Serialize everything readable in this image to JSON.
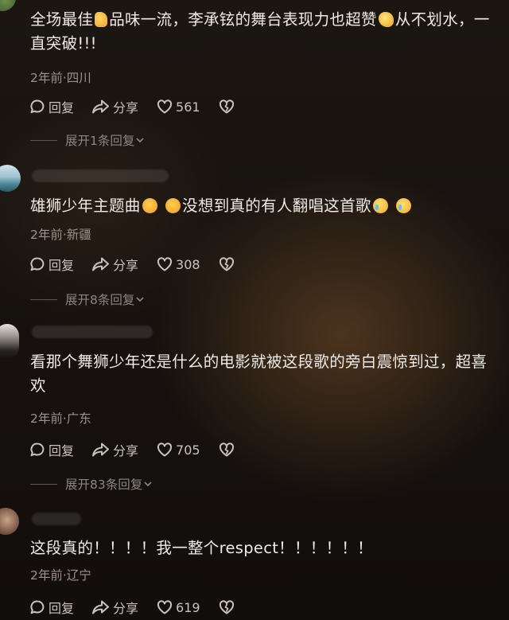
{
  "comments": [
    {
      "text_a": "全场最佳",
      "text_b": "品味一流，李承铉的舞台表现力也超赞",
      "text_c": "从不划水，一直突破!!!",
      "emoji_a": "thumbs-up-emoji",
      "emoji_b": "clapping-hands-emoji",
      "meta": "2年前·四川",
      "reply": "回复",
      "share": "分享",
      "likes": "561",
      "expand": "展开1条回复"
    },
    {
      "text_a": "雄狮少年主题曲",
      "text_b": "没想到真的有人翻唱这首歌",
      "emoji_a": "star-struck-emoji",
      "emoji_b": "crying-face-emoji",
      "meta": "2年前·新疆",
      "reply": "回复",
      "share": "分享",
      "likes": "308",
      "expand": "展开8条回复"
    },
    {
      "text": "看那个舞狮少年还是什么的电影就被这段歌的旁白震惊到过，超喜欢",
      "meta": "2年前·广东",
      "reply": "回复",
      "share": "分享",
      "likes": "705",
      "expand": "展开83条回复"
    },
    {
      "text": "这段真的！！！！我一整个respect！！！！！！",
      "meta": "2年前·辽宁",
      "reply": "回复",
      "share": "分享",
      "likes": "619"
    }
  ],
  "icons": {
    "reply": "reply-bubble-icon",
    "share": "share-arrow-icon",
    "like": "heart-icon",
    "dislike": "broken-heart-icon",
    "expand": "chevron-down-icon"
  },
  "colors": {
    "text": "#f0ebe6",
    "meta": "#9a928c",
    "action": "#c9c2bc"
  }
}
